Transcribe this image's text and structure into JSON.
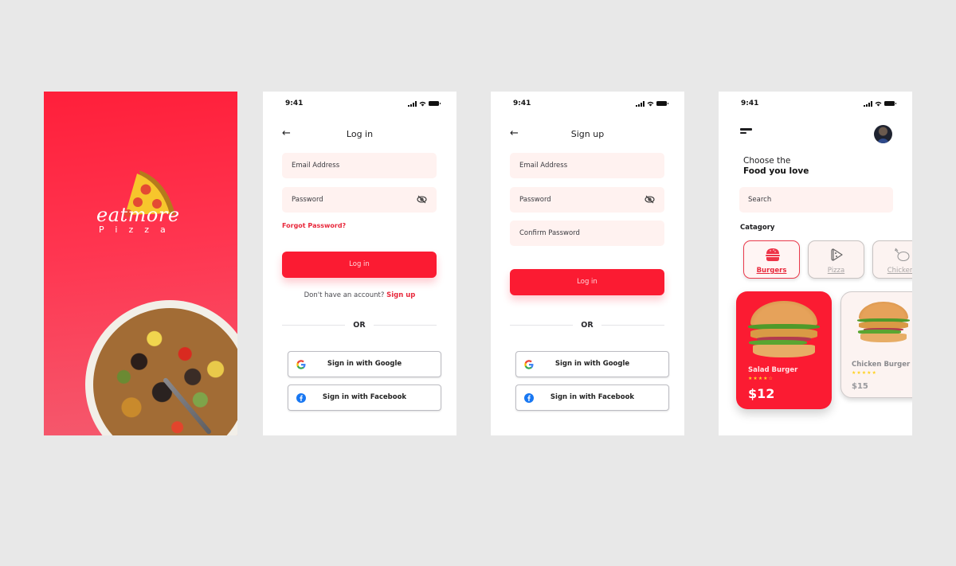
{
  "colors": {
    "brand_red": "#fb1b32",
    "field_bg": "#fff2f0",
    "link_red": "#e8283b",
    "background": "#e8e8e8"
  },
  "splash": {
    "brand_name": "eatmore",
    "brand_sub": "Pizza"
  },
  "status_bar": {
    "time": "9:41"
  },
  "login": {
    "title": "Log in",
    "email_placeholder": "Email Address",
    "password_placeholder": "Password",
    "forgot_password": "Forgot Password?",
    "login_button": "Log in",
    "no_account_text": "Don't have an account?",
    "sign_up_link": "Sign up",
    "or_label": "OR",
    "google_button": "Sign in with Google",
    "facebook_button": "Sign in with Facebook"
  },
  "signup": {
    "title": "Sign up",
    "email_placeholder": "Email Address",
    "password_placeholder": "Password",
    "confirm_password_placeholder": "Confirm Password",
    "submit_button": "Log in",
    "or_label": "OR",
    "google_button": "Sign in with Google",
    "facebook_button": "Sign in with Facebook"
  },
  "home": {
    "greeting_line1": "Choose the",
    "greeting_line2": "Food you love",
    "search_placeholder": "Search",
    "category_label": "Catagory",
    "categories": [
      {
        "label": "Burgers",
        "icon": "burger-icon",
        "active": true
      },
      {
        "label": "Pizza",
        "icon": "pizza-icon",
        "active": false
      },
      {
        "label": "Chicken",
        "icon": "chicken-icon",
        "active": false
      }
    ],
    "products": [
      {
        "name": "Salad Burger",
        "rating": 4.5,
        "rating_max": 5,
        "price": "$12",
        "highlighted": true
      },
      {
        "name": "Chicken Burger",
        "rating": 5,
        "rating_max": 5,
        "price": "$15",
        "highlighted": false
      }
    ]
  }
}
